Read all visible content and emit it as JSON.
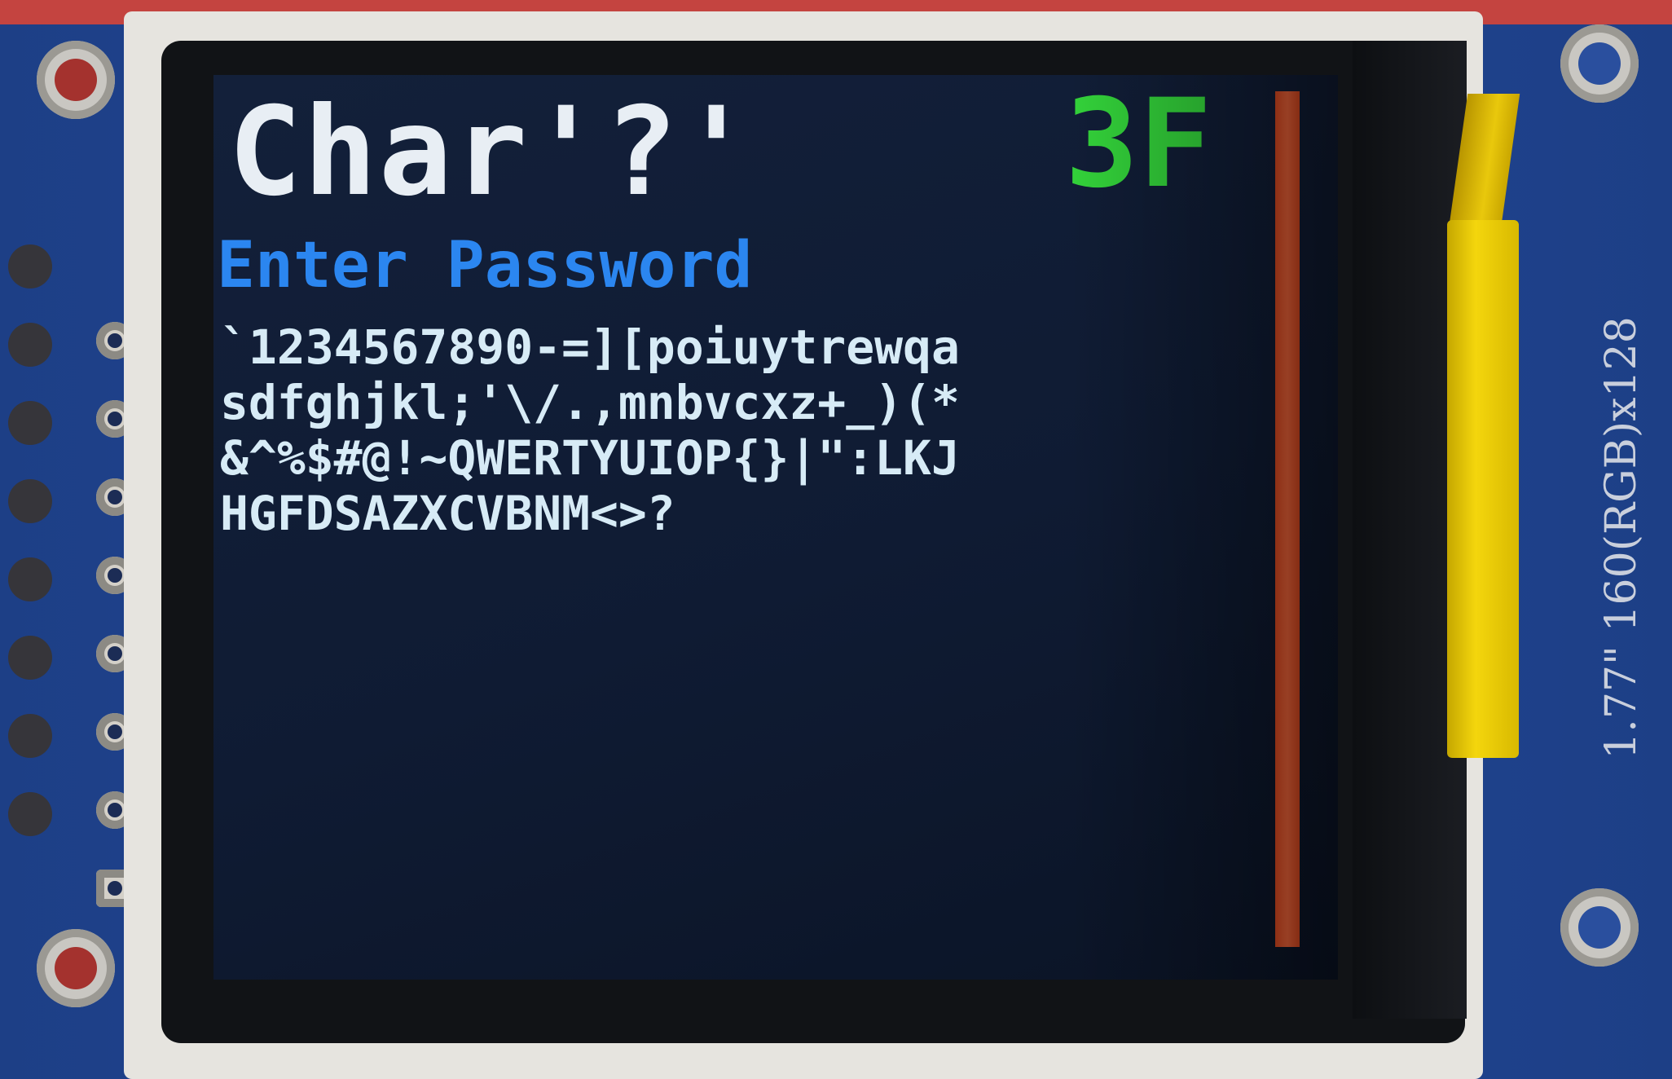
{
  "screen": {
    "title": "Char'?'",
    "code": "3F",
    "prompt": "Enter Password",
    "charset_lines": [
      "`1234567890-=][poiuytrewqa",
      "sdfghjkl;'\\/.,mnbvcxz+_)(*",
      "&^%$#@!~QWERTYUIOP{}|\":LKJ",
      "HGFDSAZXCVBNM<>?"
    ],
    "title_color": "#e8eef4",
    "code_color": "#33d23a",
    "prompt_color": "#2b86f0",
    "text_color": "#d7ebf6",
    "bar_color": "#e9582c",
    "background_color": "#111d35"
  },
  "board": {
    "label": "1.77\" 160(RGB)x128",
    "pcb_color": "#22489a"
  }
}
